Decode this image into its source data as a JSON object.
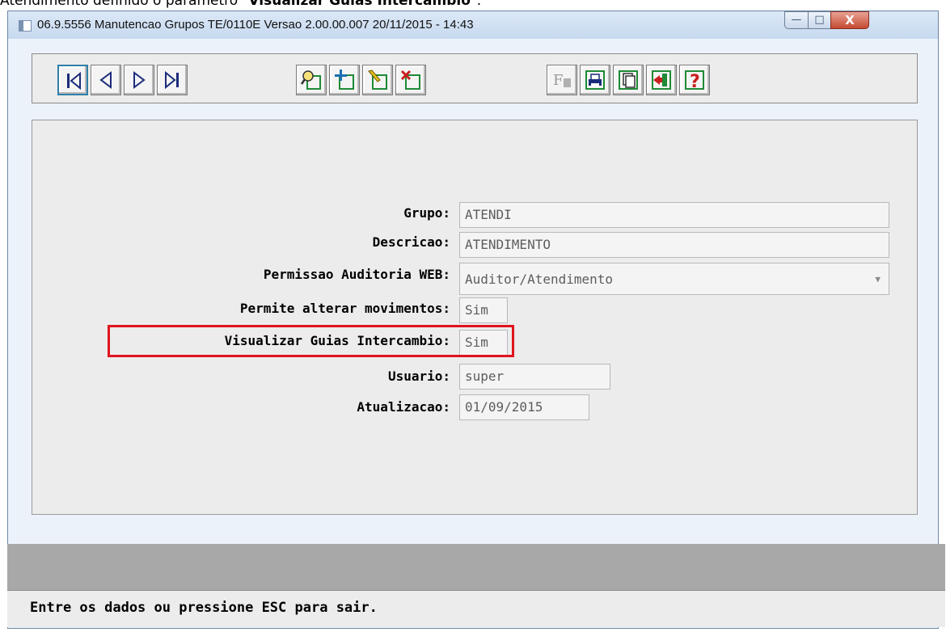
{
  "caption": {
    "prefix": "Atendimento definido o parâmetro \"",
    "bold": "Visualizar Guias Intercambio",
    "suffix": "\"."
  },
  "window": {
    "title": "06.9.5556 Manutencao   Grupos TE/0110E Versao 2.00.00.007 20/11/2015 - 14:43",
    "controls": {
      "minimize": "—",
      "maximize": "□",
      "close": "X"
    }
  },
  "toolbar": {
    "nav": [
      "first-record-icon",
      "previous-record-icon",
      "next-record-icon",
      "last-record-icon"
    ],
    "edit": [
      "search-icon",
      "add-icon",
      "edit-icon",
      "delete-icon"
    ],
    "other": [
      "filter-icon",
      "print-icon",
      "copy-icon",
      "exit-icon",
      "help-icon"
    ],
    "colors": {
      "green": "#1e8a35",
      "navy": "#1a2c7a",
      "red": "#c81e1e",
      "yellow": "#e8c21a"
    }
  },
  "form": {
    "grupo": {
      "label": "Grupo:",
      "value": "ATENDI"
    },
    "descricao": {
      "label": "Descricao:",
      "value": "ATENDIMENTO"
    },
    "permissao": {
      "label": "Permissao Auditoria WEB:",
      "value": "Auditor/Atendimento"
    },
    "permite_alterar": {
      "label": "Permite alterar movimentos:",
      "value": "Sim"
    },
    "visualizar_guias": {
      "label": "Visualizar Guias Intercambio:",
      "value": "Sim"
    },
    "usuario": {
      "label": "Usuario:",
      "value": "super"
    },
    "atualizacao": {
      "label": "Atualizacao:",
      "value": "01/09/2015"
    }
  },
  "status": {
    "message": "Entre os dados ou pressione ESC para sair."
  },
  "highlight_color": "#e0141c"
}
